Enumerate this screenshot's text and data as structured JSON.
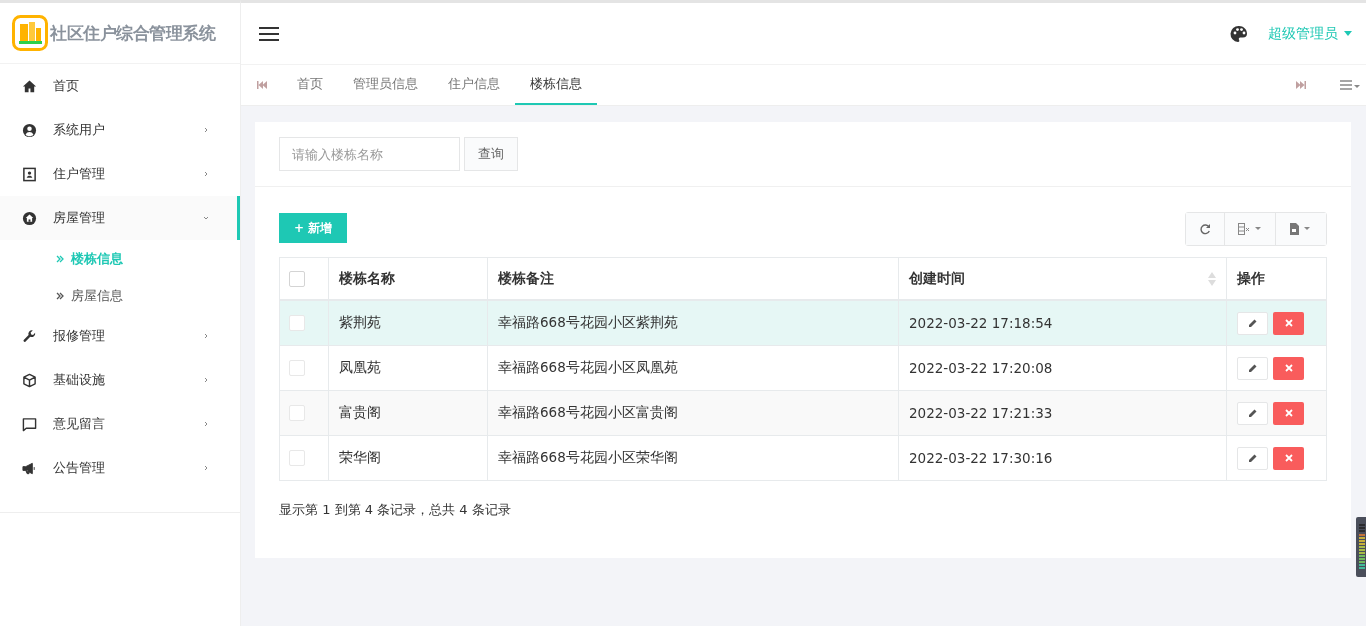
{
  "brand": {
    "title": "社区住户综合管理系统"
  },
  "user": {
    "name": "超级管理员"
  },
  "sidebar": {
    "items": [
      {
        "label": "首页",
        "selected": false
      },
      {
        "label": "系统用户",
        "selected": false,
        "expanded": false
      },
      {
        "label": "住户管理",
        "selected": false,
        "expanded": false
      },
      {
        "label": "房屋管理",
        "selected": true,
        "expanded": true,
        "children": [
          {
            "label": "楼栋信息",
            "selected": true
          },
          {
            "label": "房屋信息",
            "selected": false
          }
        ]
      },
      {
        "label": "报修管理",
        "selected": false,
        "expanded": false
      },
      {
        "label": "基础设施",
        "selected": false,
        "expanded": false
      },
      {
        "label": "意见留言",
        "selected": false,
        "expanded": false
      },
      {
        "label": "公告管理",
        "selected": false,
        "expanded": false
      }
    ]
  },
  "tabs": [
    {
      "label": "首页",
      "selected": false
    },
    {
      "label": "管理员信息",
      "selected": false
    },
    {
      "label": "住户信息",
      "selected": false
    },
    {
      "label": "楼栋信息",
      "selected": true
    }
  ],
  "search": {
    "placeholder": "请输入楼栋名称",
    "button": "查询"
  },
  "add_button": "+ 新增",
  "table": {
    "header_checked": false,
    "columns": [
      {
        "label": "楼栋名称",
        "sortable": false
      },
      {
        "label": "楼栋备注",
        "sortable": false
      },
      {
        "label": "创建时间",
        "sortable": true
      },
      {
        "label": "操作",
        "sortable": false
      }
    ],
    "rows": [
      {
        "name": "紫荆苑",
        "note": "幸福路668号花园小区紫荆苑",
        "created": "2022-03-22 17:18:54",
        "checked": false,
        "selected": true
      },
      {
        "name": "凤凰苑",
        "note": "幸福路668号花园小区凤凰苑",
        "created": "2022-03-22 17:20:08",
        "checked": false,
        "selected": false
      },
      {
        "name": "富贵阁",
        "note": "幸福路668号花园小区富贵阁",
        "created": "2022-03-22 17:21:33",
        "checked": false,
        "selected": false
      },
      {
        "name": "荣华阁",
        "note": "幸福路668号花园小区荣华阁",
        "created": "2022-03-22 17:30:16",
        "checked": false,
        "selected": false
      }
    ]
  },
  "pagination": {
    "summary": "显示第 1 到第 4 条记录，总共 4 条记录"
  }
}
